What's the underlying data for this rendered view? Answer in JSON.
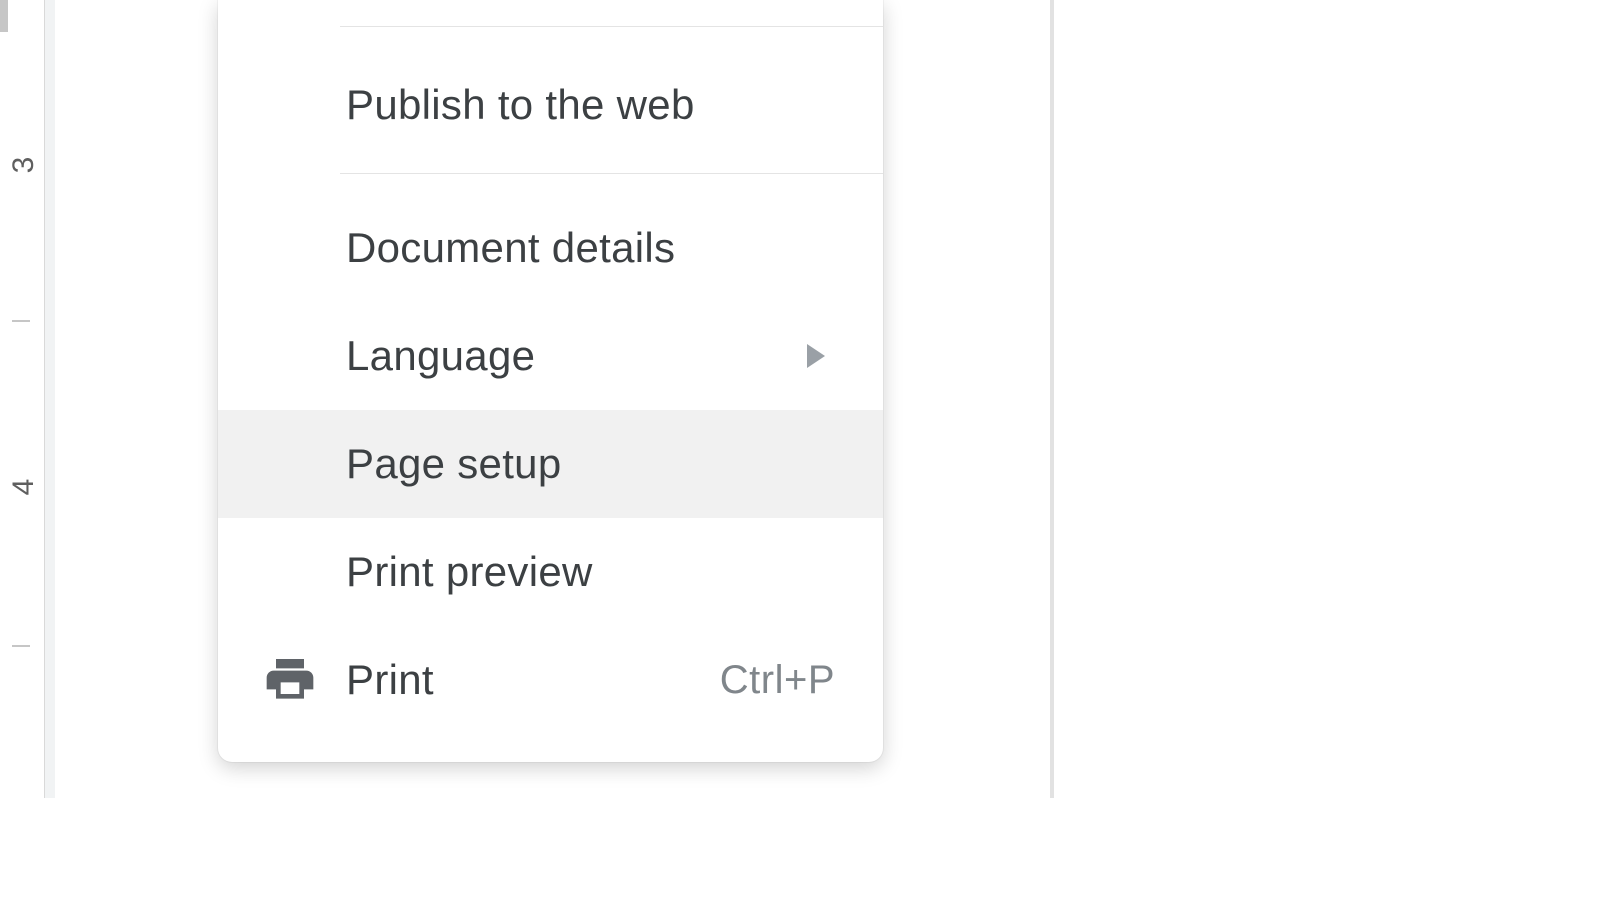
{
  "ruler": {
    "labels": [
      "3",
      "4"
    ]
  },
  "menu": {
    "publish": {
      "label": "Publish to the web"
    },
    "details": {
      "label": "Document details"
    },
    "language": {
      "label": "Language"
    },
    "pagesetup": {
      "label": "Page setup"
    },
    "preview": {
      "label": "Print preview"
    },
    "print": {
      "label": "Print",
      "shortcut": "Ctrl+P"
    }
  }
}
